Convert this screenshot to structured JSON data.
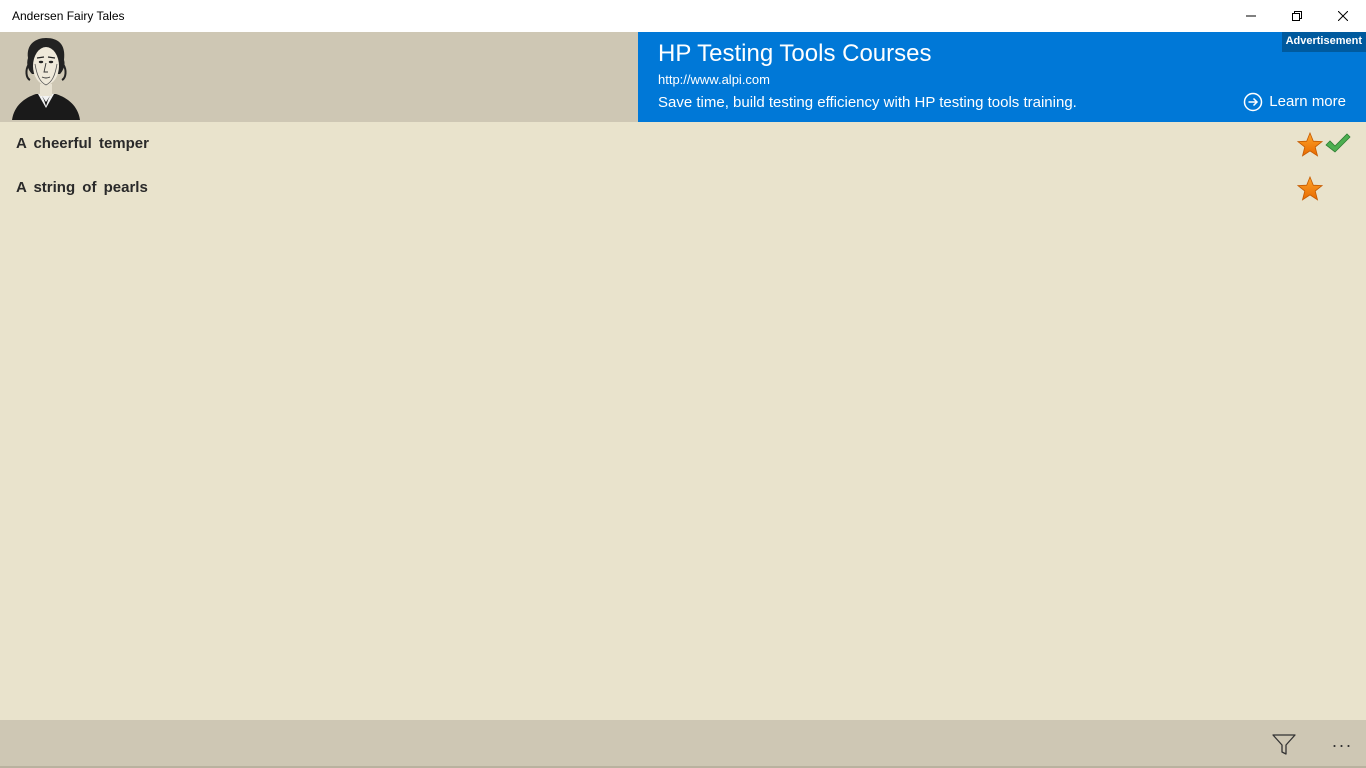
{
  "window": {
    "title": "Andersen Fairy Tales",
    "controls": {
      "minimize_icon": "minimize-icon",
      "maximize_icon": "restore-icon",
      "close_icon": "close-icon"
    }
  },
  "header": {
    "portrait_icon": "author-portrait"
  },
  "ad": {
    "title": "HP Testing Tools Courses",
    "url": "http://www.alpi.com",
    "description": "Save time, build testing efficiency with HP testing tools training.",
    "badge": "Advertisement",
    "cta": "Learn more",
    "color": "#0078d7"
  },
  "tales": [
    {
      "letter": "A",
      "title": "cheerful temper",
      "starred": true,
      "read": true
    },
    {
      "letter": "A",
      "title": "string of pearls",
      "starred": true,
      "read": false
    }
  ],
  "appbar": {
    "filter_icon": "filter-icon",
    "more": "···"
  },
  "colors": {
    "header_bg": "#cec7b4",
    "content_bg": "#e9e3cc",
    "star": "#f07d00",
    "check": "#4caf50"
  }
}
